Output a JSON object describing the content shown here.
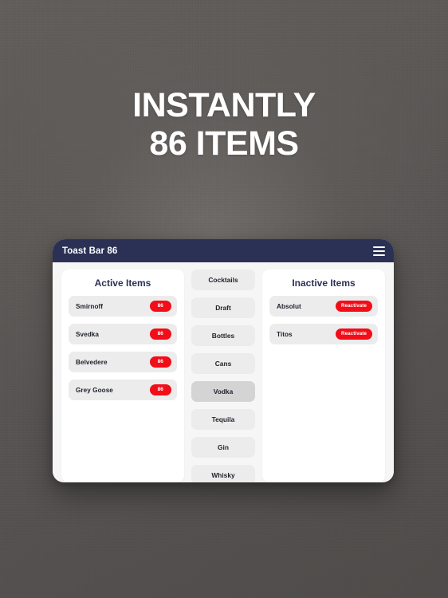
{
  "headline": {
    "line1": "INSTANTLY",
    "line2": "86 ITEMS"
  },
  "app": {
    "title": "Toast Bar 86",
    "menu_icon": "hamburger-menu-icon",
    "header_color": "#2b3154",
    "accent_color": "#f20d18"
  },
  "active_panel": {
    "title": "Active Items",
    "items": [
      {
        "name": "Smirnoff",
        "action": "86"
      },
      {
        "name": "Svedka",
        "action": "86"
      },
      {
        "name": "Belvedere",
        "action": "86"
      },
      {
        "name": "Grey Goose",
        "action": "86"
      }
    ]
  },
  "categories": {
    "selected": "Vodka",
    "items": [
      {
        "label": "Cocktails",
        "selected": false
      },
      {
        "label": "Draft",
        "selected": false
      },
      {
        "label": "Bottles",
        "selected": false
      },
      {
        "label": "Cans",
        "selected": false
      },
      {
        "label": "Vodka",
        "selected": true
      },
      {
        "label": "Tequila",
        "selected": false
      },
      {
        "label": "Gin",
        "selected": false
      },
      {
        "label": "Whisky",
        "selected": false
      }
    ]
  },
  "inactive_panel": {
    "title": "Inactive Items",
    "items": [
      {
        "name": "Absolut",
        "action": "Reactivate"
      },
      {
        "name": "Titos",
        "action": "Reactivate"
      }
    ]
  }
}
